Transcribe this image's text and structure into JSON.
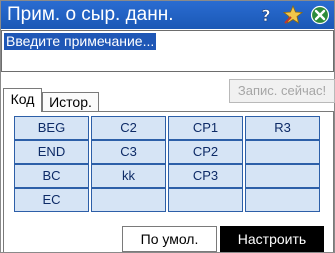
{
  "titlebar": {
    "title": "Прим. о сыр. данн.",
    "icons": [
      "help-icon",
      "pin-icon",
      "close-icon"
    ],
    "color": "#1f5fc4"
  },
  "note": {
    "placeholder": "Введите примечание..."
  },
  "record_button": {
    "label": "Запис. сейчас!"
  },
  "tabs": [
    {
      "label": "Код",
      "active": true
    },
    {
      "label": "Истор.",
      "active": false
    }
  ],
  "codes": {
    "rows": [
      [
        "BEG",
        "C2",
        "CP1",
        "R3"
      ],
      [
        "END",
        "C3",
        "CP2",
        ""
      ],
      [
        "BC",
        "kk",
        "CP3",
        ""
      ],
      [
        "EC",
        "",
        "",
        ""
      ]
    ],
    "cell_color": "#d6e4f5",
    "border_color": "#2d5fa8"
  },
  "buttons": {
    "default_label": "По умол.",
    "customize_label": "Настроить"
  }
}
